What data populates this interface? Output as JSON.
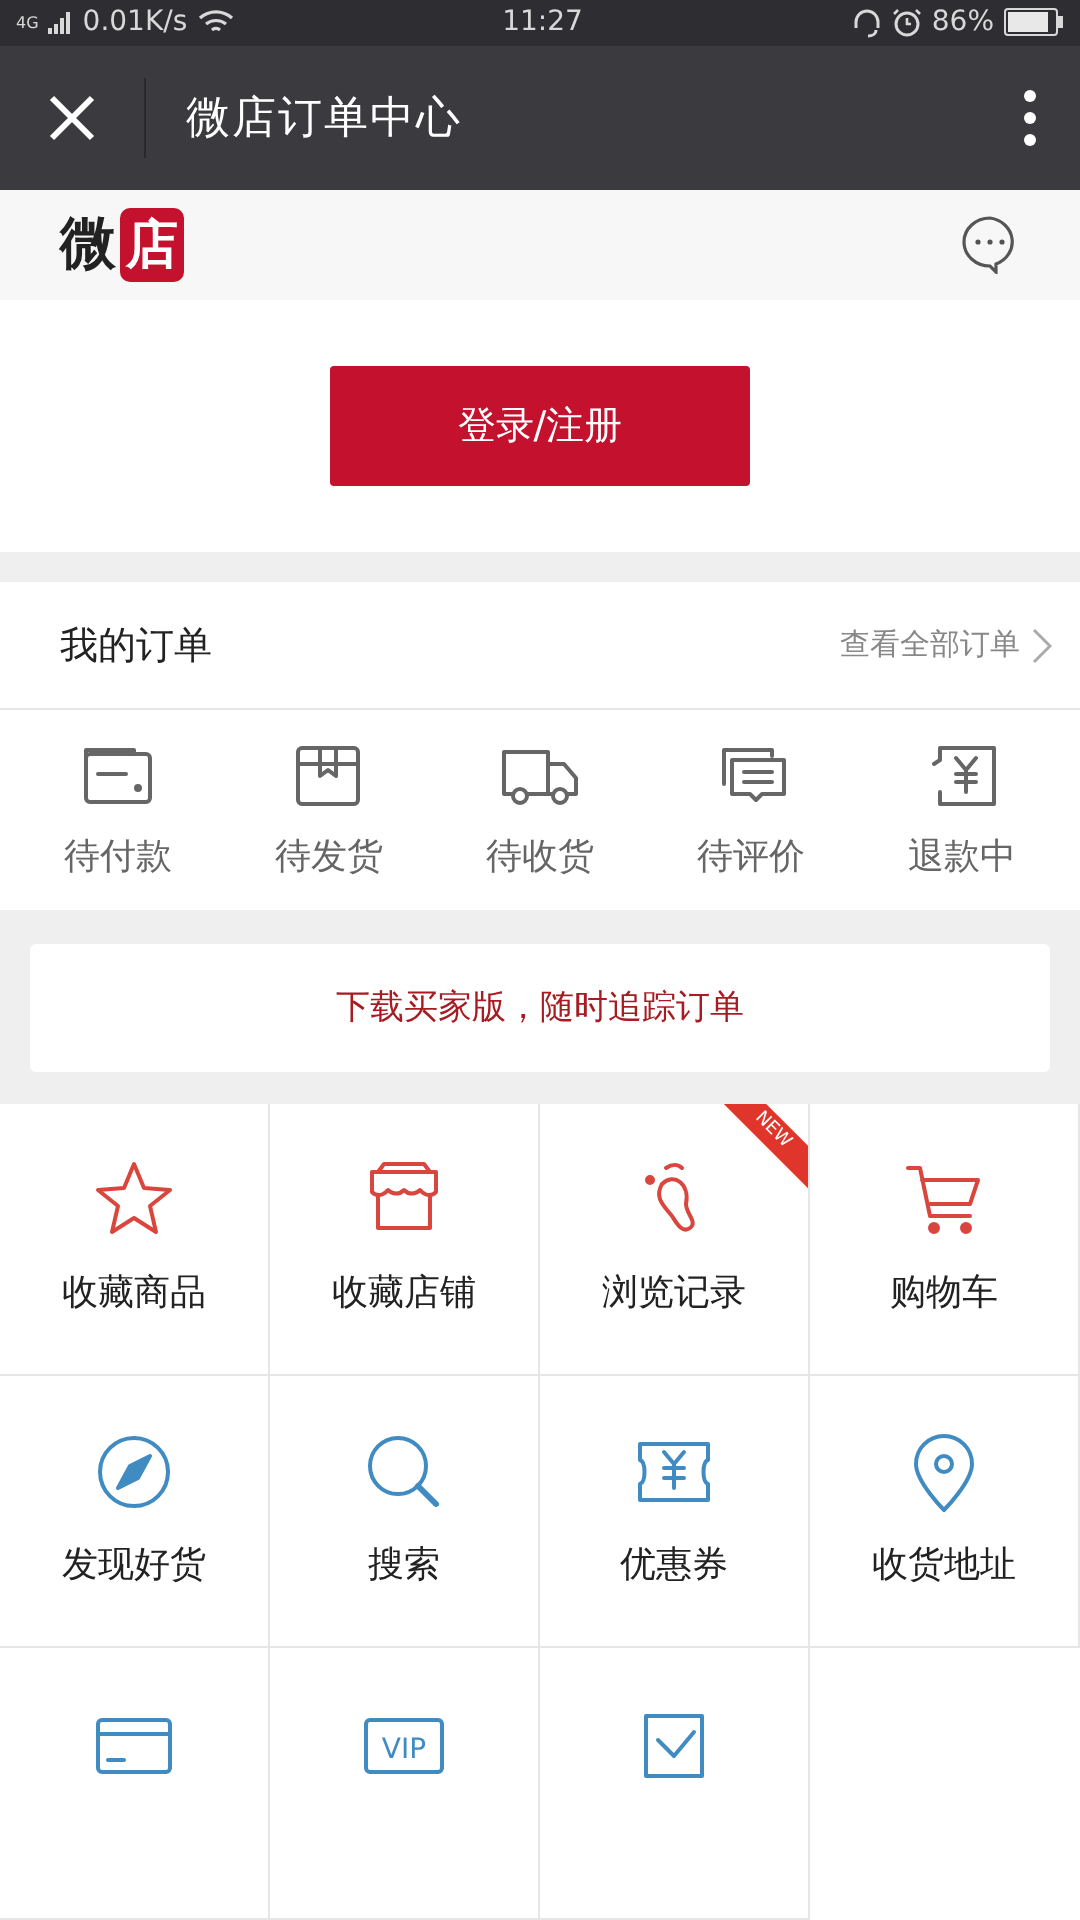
{
  "status_bar": {
    "network": "4G",
    "speed": "0.01K/s",
    "time": "11:27",
    "battery": "86%"
  },
  "title_bar": {
    "title": "微店订单中心"
  },
  "header": {
    "logo_left": "微",
    "logo_box": "店"
  },
  "login_button": "登录/注册",
  "orders": {
    "title": "我的订单",
    "link": "查看全部订单",
    "items": [
      {
        "kind": "wallet",
        "label": "待付款"
      },
      {
        "kind": "box",
        "label": "待发货"
      },
      {
        "kind": "truck",
        "label": "待收货"
      },
      {
        "kind": "chat",
        "label": "待评价"
      },
      {
        "kind": "refund",
        "label": "退款中"
      }
    ]
  },
  "banner": "下载买家版，随时追踪订单",
  "grid": [
    {
      "kind": "star",
      "label": "收藏商品",
      "color": "#d9463e"
    },
    {
      "kind": "store",
      "label": "收藏店铺",
      "color": "#d9463e"
    },
    {
      "kind": "footprint",
      "label": "浏览记录",
      "color": "#d9463e",
      "ribbon": "NEW"
    },
    {
      "kind": "cart",
      "label": "购物车",
      "color": "#d9463e"
    },
    {
      "kind": "compass",
      "label": "发现好货",
      "color": "#3f8bc2"
    },
    {
      "kind": "search",
      "label": "搜索",
      "color": "#3f8bc2"
    },
    {
      "kind": "coupon",
      "label": "优惠券",
      "color": "#3f8bc2"
    },
    {
      "kind": "pin",
      "label": "收货地址",
      "color": "#3f8bc2"
    },
    {
      "kind": "card",
      "color": "#3f8bc2"
    },
    {
      "kind": "vip",
      "color": "#3f8bc2",
      "icon_text": "VIP"
    },
    {
      "kind": "check",
      "color": "#3f8bc2"
    }
  ]
}
